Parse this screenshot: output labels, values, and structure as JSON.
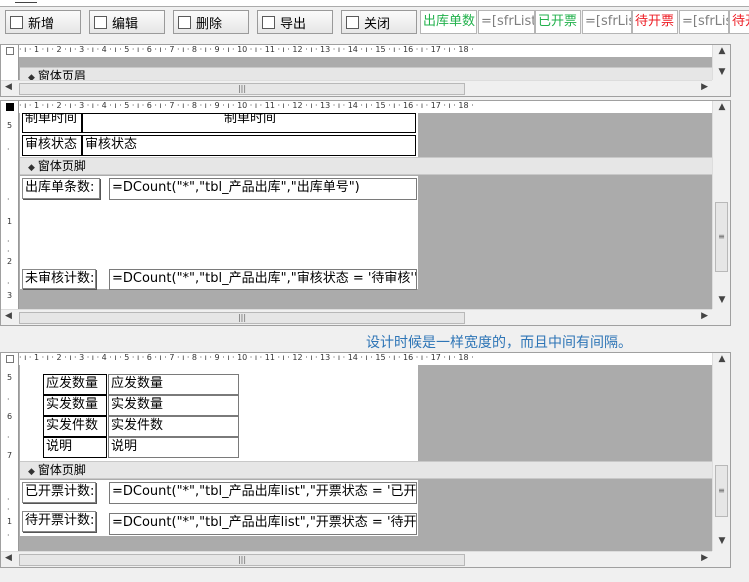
{
  "toolbar": {
    "buttons": [
      "新增",
      "编辑",
      "删除",
      "导出",
      "关闭"
    ],
    "cells": [
      {
        "text": "出库单数",
        "color": "#22b14c"
      },
      {
        "text": "=[sfrList]",
        "color": "#7f7f7f"
      },
      {
        "text": "已开票",
        "color": "#22b14c"
      },
      {
        "text": "=[sfrLis",
        "color": "#7f7f7f"
      },
      {
        "text": "待开票",
        "color": "#ed1c24"
      },
      {
        "text": "=[sfrLis",
        "color": "#7f7f7f"
      },
      {
        "text": "待开",
        "color": "#ed1c24"
      }
    ]
  },
  "ruler_text": "· ı · 1 · ı · 2 · ı · 3 · ı · 4 · ı · 5 · ı · 6 · ı · 7 · ı · 8 · ı · 9 · ı · 10 · ı · 11 · ı · 12 · ı · 13 · ı · 14 · ı · 15 · ı · 16 · ı · 17 · ı · 18 ·",
  "pane1": {
    "band": "窗体页眉"
  },
  "pane2": {
    "row1_label": "制单时间",
    "row1_value": "制单时间",
    "row2_label": "审核状态",
    "row2_value": "审核状态",
    "band": "窗体页脚",
    "count_label": "出库单条数:",
    "count_formula": "=DCount(\"*\",\"tbl_产品出库\",\"出库单号\")",
    "audit_label": "未审核计数:",
    "audit_formula": "=DCount(\"*\",\"tbl_产品出库\",\"审核状态 = '待审核'\")",
    "vruler": [
      "5",
      "·",
      "·",
      "1",
      "·",
      "·",
      "2",
      "·",
      "3"
    ]
  },
  "note": "设计时候是一样宽度的，而且中间有间隔。",
  "pane3": {
    "rows": [
      {
        "label": "应发数量",
        "value": "应发数量"
      },
      {
        "label": "实发数量",
        "value": "实发数量"
      },
      {
        "label": "实发件数",
        "value": "实发件数"
      },
      {
        "label": "说明",
        "value": "说明"
      }
    ],
    "band": "窗体页脚",
    "invoiced_label": "已开票计数:",
    "invoiced_formula": "=DCount(\"*\",\"tbl_产品出库list\",\"开票状态 = '已开票",
    "pending_label": "待开票计数:",
    "pending_formula": "=DCount(\"*\",\"tbl_产品出库list\",\"开票状态 = '待开票",
    "vruler": [
      "5",
      "·",
      "6",
      "·",
      "7",
      "·",
      "·",
      "1",
      "·"
    ]
  }
}
